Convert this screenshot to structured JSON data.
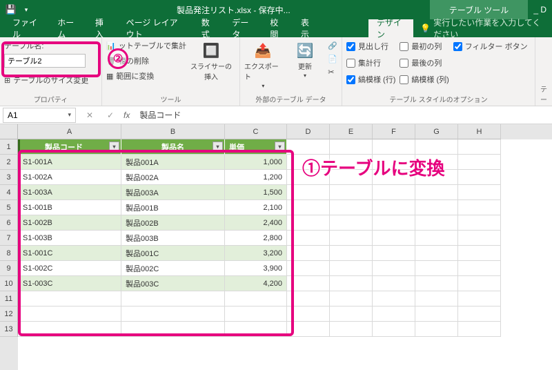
{
  "title": "製品発注リスト.xlsx - 保存中...",
  "tool_context": "テーブル ツール",
  "title_right": "_ D",
  "tabs": [
    "ファイル",
    "ホーム",
    "挿入",
    "ページ レイアウト",
    "数式",
    "データ",
    "校閲",
    "表示",
    "デザイン"
  ],
  "active_tab": "デザイン",
  "tell_me": "実行したい作業を入力してください",
  "groups": {
    "properties": {
      "name_label": "テーブル名:",
      "name_value": "テーブル2",
      "resize": "テーブルのサイズ変更",
      "label": "プロパティ"
    },
    "tools": {
      "pivot": "ットテーブルで集計",
      "remove_dup": "複の削除",
      "convert": "範囲に変換",
      "slicer": "スライサーの挿入",
      "label": "ツール"
    },
    "external": {
      "export": "エクスポート",
      "refresh": "更新",
      "label": "外部のテーブル データ"
    },
    "options": {
      "header_row": "見出し行",
      "total_row": "集計行",
      "banded_rows": "縞模様 (行)",
      "first_col": "最初の列",
      "last_col": "最後の列",
      "banded_cols": "縞模様 (列)",
      "filter_btn": "フィルター ボタン",
      "label": "テーブル スタイルのオプション"
    },
    "styles_label": "テー"
  },
  "namebox": "A1",
  "formula": "製品コード",
  "col_letters": [
    "A",
    "B",
    "C",
    "D",
    "E",
    "F",
    "G",
    "H"
  ],
  "row_numbers": [
    1,
    2,
    3,
    4,
    5,
    6,
    7,
    8,
    9,
    10,
    11,
    12,
    13
  ],
  "table": {
    "headers": [
      "製品コード",
      "製品名",
      "単価"
    ],
    "rows": [
      [
        "S1-001A",
        "製品001A",
        "1,000"
      ],
      [
        "S1-002A",
        "製品002A",
        "1,200"
      ],
      [
        "S1-003A",
        "製品003A",
        "1,500"
      ],
      [
        "S1-001B",
        "製品001B",
        "2,100"
      ],
      [
        "S1-002B",
        "製品002B",
        "2,400"
      ],
      [
        "S1-003B",
        "製品003B",
        "2,800"
      ],
      [
        "S1-001C",
        "製品001C",
        "3,200"
      ],
      [
        "S1-002C",
        "製品002C",
        "3,900"
      ],
      [
        "S1-003C",
        "製品003C",
        "4,200"
      ]
    ]
  },
  "annotations": {
    "circle": "②",
    "text": "①テーブルに変換"
  }
}
